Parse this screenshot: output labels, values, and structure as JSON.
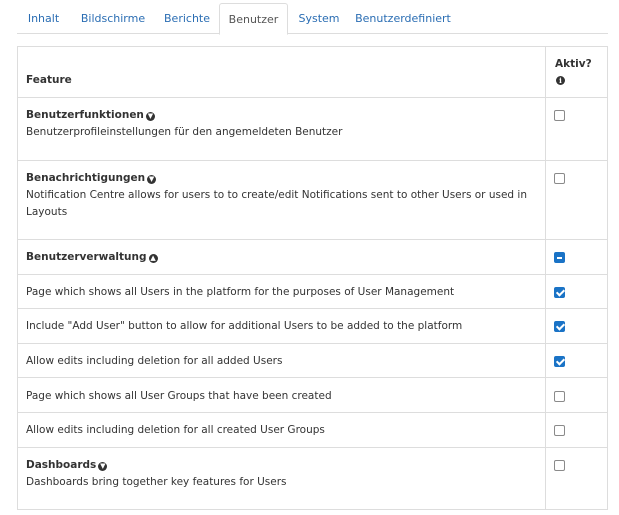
{
  "tabs": [
    {
      "label": "Inhalt",
      "active": false
    },
    {
      "label": "Bildschirme",
      "active": false
    },
    {
      "label": "Berichte",
      "active": false
    },
    {
      "label": "Benutzer",
      "active": true
    },
    {
      "label": "System",
      "active": false
    },
    {
      "label": "Benutzerdefiniert",
      "active": false
    }
  ],
  "table": {
    "header_feature": "Feature",
    "header_active": "Aktiv?",
    "info_icon": "info-circle-icon",
    "rows": [
      {
        "title": "Benutzerfunktionen",
        "description": "Benutzerprofileinstellungen für den angemeldeten Benutzer",
        "toggle": "expand",
        "state": "unchecked"
      },
      {
        "title": "Benachrichtigungen",
        "description": "Notification Centre allows for users to to create/edit Notifications sent to other Users or used in Layouts",
        "toggle": "expand",
        "state": "unchecked"
      },
      {
        "title": "Benutzerverwaltung",
        "description": "",
        "toggle": "collapse",
        "state": "partial"
      },
      {
        "title": "",
        "description": "Page which shows all Users in the platform for the purposes of User Management",
        "state": "checked"
      },
      {
        "title": "",
        "description": "Include \"Add User\" button to allow for additional Users to be added to the platform",
        "state": "checked"
      },
      {
        "title": "",
        "description": "Allow edits including deletion for all added Users",
        "state": "checked"
      },
      {
        "title": "",
        "description": "Page which shows all User Groups that have been created",
        "state": "unchecked"
      },
      {
        "title": "",
        "description": "Allow edits including deletion for all created User Groups",
        "state": "unchecked"
      },
      {
        "title": "Dashboards",
        "description": "Dashboards bring together key features for Users",
        "toggle": "expand",
        "state": "unchecked"
      }
    ]
  },
  "colors": {
    "link": "#2a6db3",
    "checkbox_checked": "#1a73c6",
    "border": "#dddddd"
  }
}
